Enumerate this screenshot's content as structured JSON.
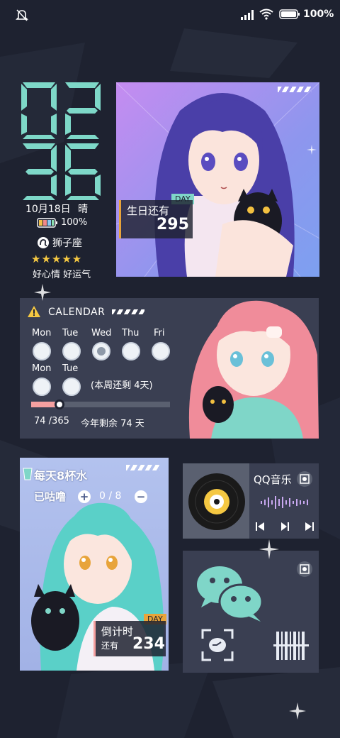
{
  "status": {
    "battery_pct": "100%",
    "icons": [
      "mute-bell-icon",
      "signal-icon",
      "wifi-icon",
      "battery-icon"
    ]
  },
  "clock": {
    "hour": "02",
    "minute": "36"
  },
  "date": {
    "date": "10月18日",
    "weather": "晴",
    "battery": "100%",
    "zodiac": "狮子座",
    "rating": 5,
    "mood": "好心情 好运气"
  },
  "birthday": {
    "day_tag": "DAY",
    "label": "生日还有",
    "days": "295"
  },
  "calendar": {
    "title": "CALENDAR",
    "days": [
      "Mon",
      "Tue",
      "Wed",
      "Thu",
      "Fri",
      "Mon",
      "Tue"
    ],
    "current_index": 2,
    "remaining": "(本周还剩 4天)",
    "progress": 0.2027,
    "progress_text": "74 /365",
    "year_left": "今年剩余 74 天"
  },
  "water": {
    "title": "每天8杯水",
    "drunk_label": "已咕噜",
    "count": "0 / 8"
  },
  "countdown": {
    "day_tag": "DAY",
    "label": "倒计时",
    "sub": "还有",
    "days": "234"
  },
  "music": {
    "app": "QQ音乐",
    "controls": [
      "previous-icon",
      "play-pause-icon",
      "next-icon"
    ]
  },
  "wechat": {
    "icons": [
      "wechat-icon",
      "scan-icon",
      "barcode-icon"
    ]
  },
  "colors": {
    "accent": "#e8a43a",
    "teal": "#7fd6c8",
    "pink": "#f5a0a0"
  }
}
